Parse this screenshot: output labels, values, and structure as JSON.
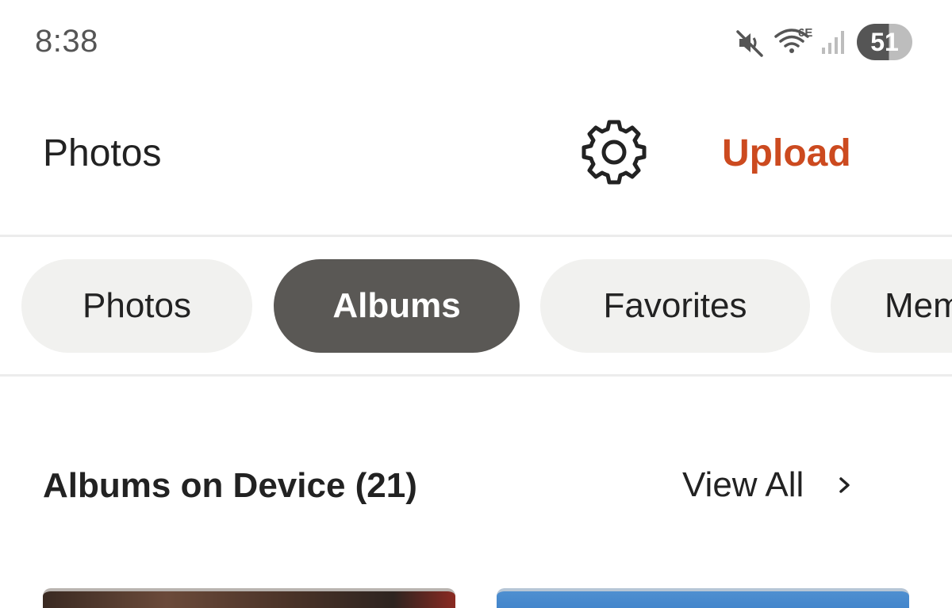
{
  "status_bar": {
    "time": "8:38",
    "wifi_label": "6E",
    "battery": "51"
  },
  "header": {
    "title": "Photos",
    "settings_icon": "gear-icon",
    "upload_label": "Upload",
    "accent_color": "#cc4a1f"
  },
  "tabs": [
    {
      "label": "Photos",
      "active": false
    },
    {
      "label": "Albums",
      "active": true
    },
    {
      "label": "Favorites",
      "active": false
    },
    {
      "label": "Memories",
      "active": false
    }
  ],
  "section": {
    "title": "Albums on Device (21)",
    "view_all_label": "View All"
  },
  "colors": {
    "active_tab_bg": "#5a5855",
    "inactive_tab_bg": "#f1f1ef"
  }
}
